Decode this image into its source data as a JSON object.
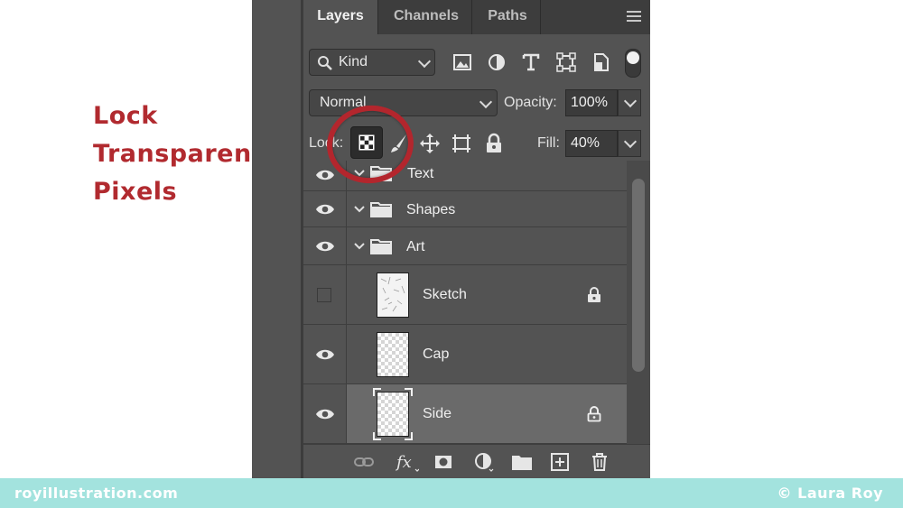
{
  "caption": {
    "line1": "Lock",
    "line2": "Transparent",
    "line3": "Pixels"
  },
  "tabs": [
    {
      "label": "Layers",
      "active": true
    },
    {
      "label": "Channels",
      "active": false
    },
    {
      "label": "Paths",
      "active": false
    }
  ],
  "filter": {
    "kind_label": "Kind",
    "icons": [
      "image-filter-icon",
      "adjustment-filter-icon",
      "type-filter-icon",
      "shape-filter-icon",
      "smart-object-filter-icon",
      "filter-toggle"
    ]
  },
  "blend": {
    "mode": "Normal",
    "opacity_label": "Opacity:",
    "opacity_value": "100%"
  },
  "lock": {
    "label": "Lock:",
    "selected": "lock-transparent-pixels-icon",
    "fill_label": "Fill:",
    "fill_value": "40%"
  },
  "layers": [
    {
      "name": "Text",
      "type": "group",
      "visible": true,
      "locked": false,
      "selected": false
    },
    {
      "name": "Shapes",
      "type": "group",
      "visible": true,
      "locked": false,
      "selected": false
    },
    {
      "name": "Art",
      "type": "group",
      "visible": true,
      "locked": false,
      "selected": false
    },
    {
      "name": "Sketch",
      "type": "layer",
      "visible": false,
      "locked": true,
      "selected": false
    },
    {
      "name": "Cap",
      "type": "layer",
      "visible": true,
      "locked": false,
      "selected": false
    },
    {
      "name": "Side",
      "type": "layer",
      "visible": true,
      "locked": true,
      "selected": true
    }
  ],
  "footer": {
    "left": "royillustration.com",
    "right": "© Laura Roy"
  },
  "colors": {
    "accent_red": "#b12a2f",
    "panel_bg": "#535353",
    "footer_bg": "#a3e3de"
  }
}
